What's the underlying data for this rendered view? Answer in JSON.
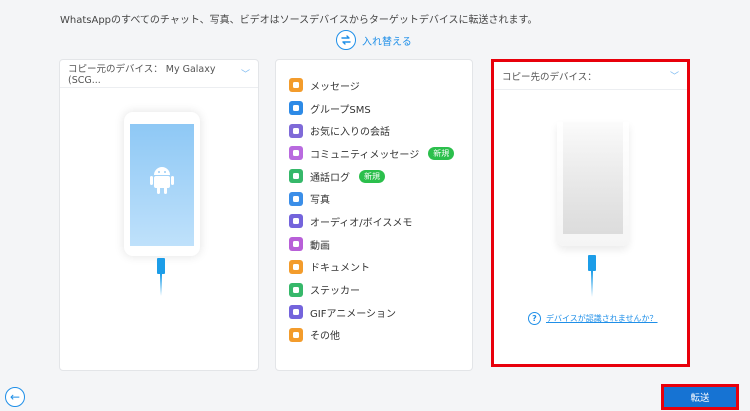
{
  "header": {
    "description": "WhatsAppのすべてのチャット、写真、ビデオはソースデバイスからターゲットデバイスに転送されます。",
    "swap_label": "入れ替える"
  },
  "source": {
    "label": "コピー元のデバイス：",
    "device": "My Galaxy (SCG..."
  },
  "target": {
    "label": "コピー先のデバイス：",
    "help_text": "デバイスが認識されませんか？"
  },
  "items": [
    {
      "label": "メッセージ",
      "icon": "message-icon",
      "color": "#f39c2c"
    },
    {
      "label": "グループSMS",
      "icon": "group-sms-icon",
      "color": "#2d8ae6"
    },
    {
      "label": "お気に入りの会話",
      "icon": "favorite-star-icon",
      "color": "#7f6ad8"
    },
    {
      "label": "コミュニティメッセージ",
      "icon": "community-icon",
      "color": "#b96adf",
      "badge": "新規"
    },
    {
      "label": "通話ログ",
      "icon": "call-log-icon",
      "color": "#36b86a",
      "badge": "新規"
    },
    {
      "label": "写真",
      "icon": "photo-icon",
      "color": "#3b8ee8"
    },
    {
      "label": "オーディオ/ボイスメモ",
      "icon": "audio-icon",
      "color": "#7464dc"
    },
    {
      "label": "動画",
      "icon": "video-icon",
      "color": "#b85fd8"
    },
    {
      "label": "ドキュメント",
      "icon": "document-icon",
      "color": "#f39c2c"
    },
    {
      "label": "ステッカー",
      "icon": "sticker-icon",
      "color": "#36b86a"
    },
    {
      "label": "GIFアニメーション",
      "icon": "gif-icon",
      "color": "#7464dc"
    },
    {
      "label": "その他",
      "icon": "other-icon",
      "color": "#f39c2c"
    }
  ],
  "footer": {
    "transfer_label": "転送"
  },
  "colors": {
    "accent": "#1f8fe8",
    "highlight_border": "#e8000b",
    "badge": "#2bbf4c",
    "primary_button": "#1673d3"
  }
}
